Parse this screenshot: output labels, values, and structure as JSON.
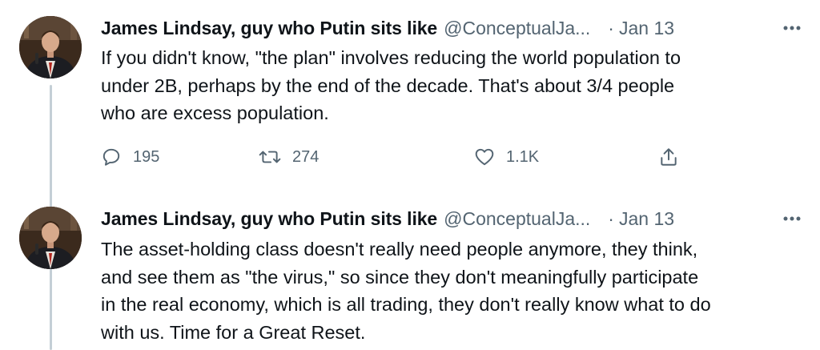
{
  "tweets": [
    {
      "author_name": "James Lindsay, guy who Putin sits like",
      "handle": "@ConceptualJa...",
      "separator": "·",
      "date": "Jan 13",
      "more": "•••",
      "text": "If you didn't know, \"the plan\" involves reducing the world population to\nunder 2B, perhaps by the end of the decade. That's about 3/4 people\nwho are excess population.",
      "replies": "195",
      "retweets": "274",
      "likes": "1.1K"
    },
    {
      "author_name": "James Lindsay, guy who Putin sits like",
      "handle": "@ConceptualJa...",
      "separator": "·",
      "date": "Jan 13",
      "more": "•••",
      "text": "The asset-holding class doesn't really need people anymore, they think,\nand see them as \"the virus,\" so since they don't meaningfully participate\nin the real economy, which is all trading, they don't really know what to do\nwith us. Time for a Great Reset."
    }
  ],
  "icons": {
    "reply": "reply-icon",
    "retweet": "retweet-icon",
    "like": "heart-icon",
    "share": "share-icon",
    "more": "more-icon"
  },
  "colors": {
    "text": "#0f1419",
    "secondary": "#536471",
    "thread_line": "#c4cfd6"
  }
}
